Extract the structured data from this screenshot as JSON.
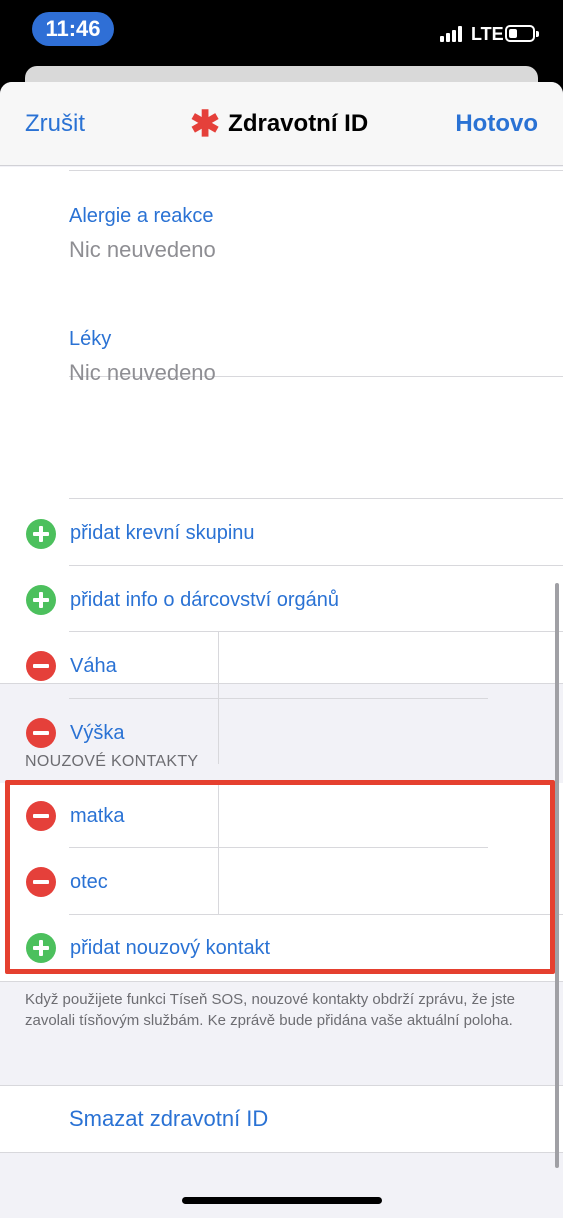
{
  "status": {
    "time": "11:46",
    "network": "LTE"
  },
  "nav": {
    "cancel": "Zrušit",
    "title_icon": "✱",
    "title": "Zdravotní ID",
    "done": "Hotovo"
  },
  "fields": [
    {
      "label": "Alergie a reakce",
      "value": "Nic neuvedeno"
    },
    {
      "label": "Léky",
      "value": "Nic neuvedeno"
    }
  ],
  "rows": {
    "add_blood": "přidat krevní skupinu",
    "add_organ": "přidat info o dárcovství orgánů",
    "weight": "Váha",
    "height": "Výška"
  },
  "emergency": {
    "header": "NOUZOVÉ KONTAKTY",
    "contacts": [
      "matka",
      "otec"
    ],
    "add": "přidat nouzový kontakt",
    "footer": "Když použijete funkci Tíseň SOS, nouzové kontakty obdrží zprávu, že jste zavolali tísňovým službám. Ke zprávě bude přidána vaše aktuální poloha."
  },
  "delete_button": "Smazat zdravotní ID",
  "colors": {
    "accent": "#2a72d4",
    "add": "#4cc05d",
    "remove": "#e5403a",
    "highlight": "#e5402f"
  }
}
